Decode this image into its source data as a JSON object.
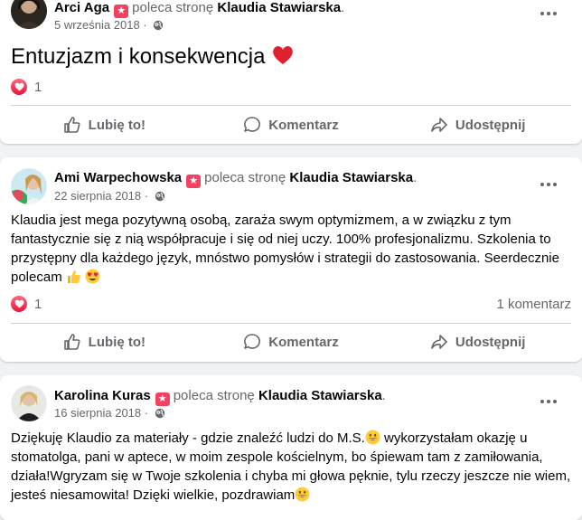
{
  "actions": {
    "like": "Lubię to!",
    "comment": "Komentarz",
    "share": "Udostępnij"
  },
  "posts": [
    {
      "author": "Arci Aga",
      "verb": "poleca stronę",
      "page": "Klaudia Stawiarska",
      "date": "5 września 2018",
      "text": "Entuzjazm i konsekwencja",
      "reactions": "1",
      "comments": ""
    },
    {
      "author": "Ami Warpechowska",
      "verb": "poleca stronę",
      "page": "Klaudia Stawiarska",
      "date": "22 sierpnia 2018",
      "text": "Klaudia jest mega pozytywną osobą, zaraża swym optymizmem, a w związku z tym fantastycznie się z nią współpracuje i się od niej uczy. 100% profesjonalizmu. Szkolenia to przystępny dla każdego język, mnóstwo pomysłów i strategii do zastosowania. Seerdecznie polecam",
      "reactions": "1",
      "comments": "1 komentarz"
    },
    {
      "author": "Karolina Kuras",
      "verb": "poleca stronę",
      "page": "Klaudia Stawiarska",
      "date": "16 sierpnia 2018",
      "text": "Dziękuję Klaudio za materiały - gdzie znaleźć ludzi do M.S.",
      "text2": " wykorzystałam okazję u stomatolga, pani w aptece, w moim zespole kościelnym, bo śpiewam tam z zamiłowania, działa!Wgryzam się w Twoje szkolenia i chyba mi głowa pęknie, tylu rzeczy jeszcze nie wiem, jesteś niesamowita! Dzięki wielkie, pozdrawiam",
      "reactions": "",
      "comments": ""
    }
  ],
  "colors": {
    "background": "#f0f2f5",
    "card": "#ffffff",
    "secondary_text": "#65676b",
    "recommend_badge": "#f3425f",
    "heart": "#e61739"
  },
  "icons": [
    "recommend-star-icon",
    "globe-icon",
    "more-options-icon",
    "heart-reaction-icon",
    "like-thumb-icon",
    "comment-bubble-icon",
    "share-arrow-icon",
    "heart-emoji",
    "thumbs-up-emoji",
    "heart-eyes-emoji",
    "grinning-emoji"
  ]
}
